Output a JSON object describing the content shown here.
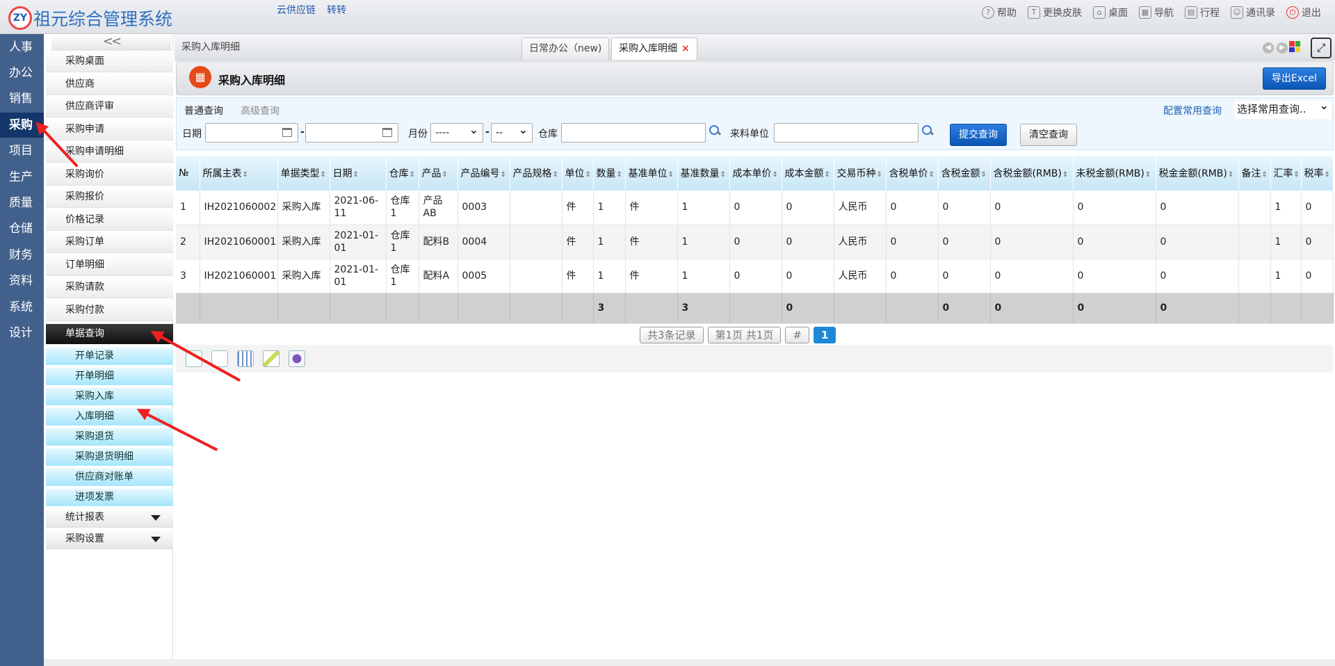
{
  "header": {
    "title": "祖元综合管理系统",
    "links": [
      "云供应链",
      "转转"
    ],
    "right_items": [
      {
        "label": "帮助",
        "icon": "help-icon"
      },
      {
        "label": "更换皮肤",
        "icon": "shirt-icon"
      },
      {
        "label": "桌面",
        "icon": "home-icon"
      },
      {
        "label": "导航",
        "icon": "navigation-icon"
      },
      {
        "label": "行程",
        "icon": "calendar-icon"
      },
      {
        "label": "通讯录",
        "icon": "contacts-icon"
      },
      {
        "label": "退出",
        "icon": "power-icon"
      }
    ]
  },
  "modules": [
    "人事",
    "办公",
    "销售",
    "采购",
    "项目",
    "生产",
    "质量",
    "仓储",
    "财务",
    "资料",
    "系统",
    "设计"
  ],
  "active_module": "采购",
  "sidebar": {
    "collapse_glyph": "<<",
    "items": [
      "采购桌面",
      "供应商",
      "供应商评审",
      "采购申请",
      "采购申请明细",
      "采购询价",
      "采购报价",
      "价格记录",
      "采购订单",
      "订单明细",
      "采购请款",
      "采购付款"
    ],
    "group": "单据查询",
    "subitems": [
      "开单记录",
      "开单明细",
      "采购入库",
      "入库明细",
      "采购退货",
      "采购退货明细",
      "供应商对账单",
      "进项发票"
    ],
    "collapsed_groups": [
      "统计报表",
      "采购设置"
    ]
  },
  "tabs": {
    "breadcrumb": "采购入库明细",
    "items": [
      {
        "label": "日常办公（new)",
        "active": false
      },
      {
        "label": "采购入库明细",
        "active": true
      }
    ],
    "close_glyph": "×"
  },
  "page": {
    "title": "采购入库明细",
    "export_label": "导出Excel"
  },
  "query": {
    "tab_normal": "普通查询",
    "tab_advanced": "高级查询",
    "date_label": "日期",
    "date_sep": "-",
    "month_label": "月份",
    "year_value": "----",
    "month_sep": "-",
    "month_value": "--",
    "warehouse_label": "仓库",
    "supplier_label": "来料单位",
    "submit_label": "提交查询",
    "clear_label": "清空查询",
    "config_label": "配置常用查询",
    "common_select": "选择常用查询.."
  },
  "table": {
    "columns": [
      "№",
      "所属主表",
      "单据类型",
      "日期",
      "仓库",
      "产品",
      "产品编号",
      "产品规格",
      "单位",
      "数量",
      "基准单位",
      "基准数量",
      "成本单价",
      "成本金额",
      "交易币种",
      "含税单价",
      "含税金额",
      "含税金额(RMB)",
      "未税金额(RMB)",
      "税金金额(RMB)",
      "备注",
      "汇率",
      "税率"
    ],
    "rows": [
      [
        "1",
        "IH2021060002",
        "采购入库",
        "2021-06-11",
        "仓库1",
        "产品AB",
        "0003",
        "",
        "件",
        "1",
        "件",
        "1",
        "0",
        "0",
        "人民币",
        "0",
        "0",
        "0",
        "0",
        "0",
        "",
        "1",
        "0"
      ],
      [
        "2",
        "IH2021060001",
        "采购入库",
        "2021-01-01",
        "仓库1",
        "配料B",
        "0004",
        "",
        "件",
        "1",
        "件",
        "1",
        "0",
        "0",
        "人民币",
        "0",
        "0",
        "0",
        "0",
        "0",
        "",
        "1",
        "0"
      ],
      [
        "3",
        "IH2021060001",
        "采购入库",
        "2021-01-01",
        "仓库1",
        "配料A",
        "0005",
        "",
        "件",
        "1",
        "件",
        "1",
        "0",
        "0",
        "人民币",
        "0",
        "0",
        "0",
        "0",
        "0",
        "",
        "1",
        "0"
      ]
    ],
    "totals": [
      "",
      "",
      "",
      "",
      "",
      "",
      "",
      "",
      "",
      "3",
      "",
      "3",
      "",
      "0",
      "",
      "",
      "0",
      "0",
      "0",
      "0",
      "",
      "",
      ""
    ]
  },
  "pager": {
    "records": "共3条记录",
    "pages": "第1页 共1页",
    "hash": "#",
    "current": "1"
  },
  "colors": {
    "module_bar": "#42608c",
    "accent_blue": "#0a56b5",
    "annotation_red": "#f02020"
  }
}
